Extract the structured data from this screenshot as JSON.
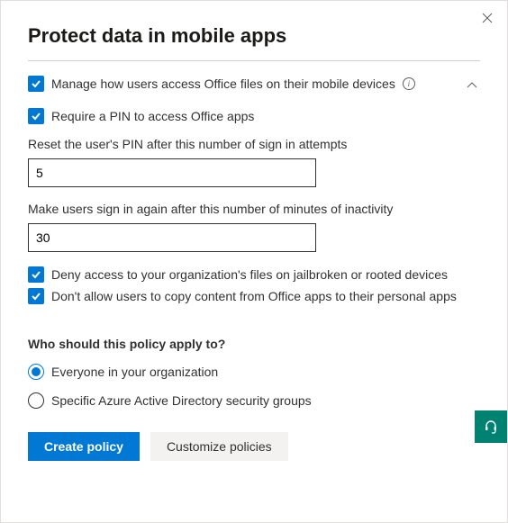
{
  "title": "Protect data in mobile apps",
  "options": {
    "manage_access": "Manage how users access Office files on their mobile devices",
    "require_pin": "Require a PIN to access Office apps",
    "reset_pin_label": "Reset the user's PIN after this number of sign in attempts",
    "reset_pin_value": "5",
    "inactivity_label": "Make users sign in again after this number of minutes of inactivity",
    "inactivity_value": "30",
    "deny_jailbroken": "Deny access to your organization's files on jailbroken or rooted devices",
    "no_copy": "Don't allow users to copy content from Office apps to their personal apps"
  },
  "apply": {
    "heading": "Who should this policy apply to?",
    "everyone": "Everyone in your organization",
    "groups": "Specific Azure Active Directory security groups"
  },
  "buttons": {
    "create": "Create policy",
    "customize": "Customize policies"
  }
}
